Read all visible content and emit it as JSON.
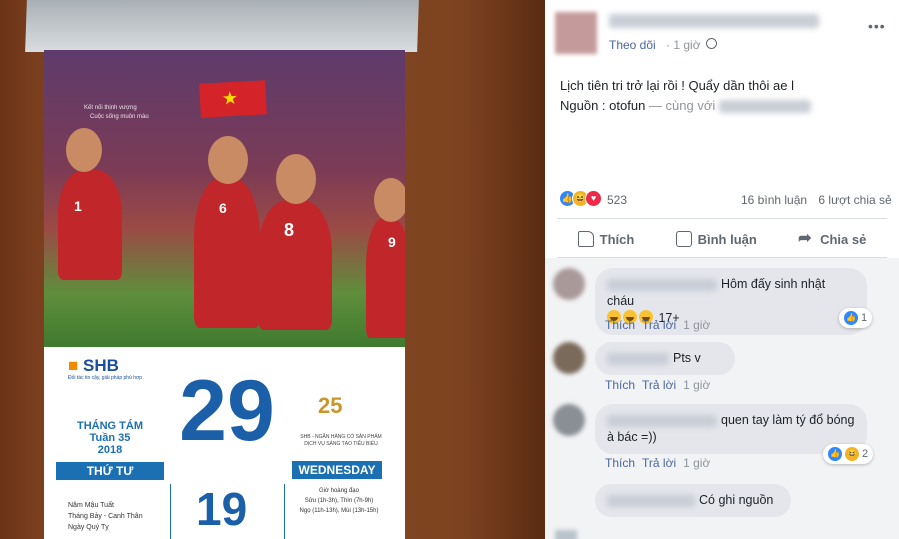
{
  "photo": {
    "slogan_lines": [
      "Kết nối thịnh vượng",
      "Cuộc sống muôn màu"
    ],
    "bank_name": "SHB",
    "bank_tagline": "Đối tác tin cậy, giải pháp phù hợp",
    "month_label": "THÁNG TÁM",
    "week_label": "Tuần 35",
    "year": "2018",
    "weekday_vn": "THỨ TƯ",
    "day": "29",
    "anniversary": "25",
    "anniversary_caption": "SHB - NGÂN HÀNG CÓ SẢN PHẨM DỊCH VỤ SÁNG TẠO TIÊU BIỂU",
    "weekday_en": "WEDNESDAY",
    "lunar_day": "19",
    "lunar_info": [
      "Năm Mậu Tuất",
      "Tháng Bảy - Canh Thân",
      "Ngày Quý Tỵ"
    ],
    "good_hours_title": "Giờ hoàng đạo",
    "good_hours": [
      "Sửu (1h-3h), Thìn (7h-9h)",
      "Ngọ (11h-13h), Mùi (13h-15h)"
    ],
    "jersey_numbers": [
      "1",
      "6",
      "8",
      "9"
    ]
  },
  "post": {
    "follow_label": "Theo dõi",
    "time": "1 giờ",
    "text_line1": "Lịch tiên tri trở lại rồi ! Quẩy dần thôi ae l",
    "source_label": "Nguồn : ",
    "source_name": "otofun",
    "with_label": " — cùng với",
    "reaction_count": "523",
    "comments_count": "16 bình luận",
    "shares_count": "6 lượt chia sẻ",
    "actions": {
      "like": "Thích",
      "comment": "Bình luận",
      "share": "Chia sẻ"
    }
  },
  "comments": [
    {
      "text": "Hôm đấy sinh nhật cháu",
      "text2": "17+",
      "like": "Thích",
      "reply": "Trả lời",
      "time": "1 giờ",
      "reaction_count": "1"
    },
    {
      "text": "Pts v",
      "like": "Thích",
      "reply": "Trả lời",
      "time": "1 giờ"
    },
    {
      "text": "quen tay làm tý đổ bóng",
      "text2": "à bác =))",
      "like": "Thích",
      "reply": "Trả lời",
      "time": "1 giờ",
      "reaction_count": "2"
    },
    {
      "text": "Có ghi nguồn"
    }
  ],
  "colors": {
    "fb_link": "#4b67a1",
    "fb_like": "#2d88ff",
    "calendar_blue": "#1a5fa8"
  }
}
